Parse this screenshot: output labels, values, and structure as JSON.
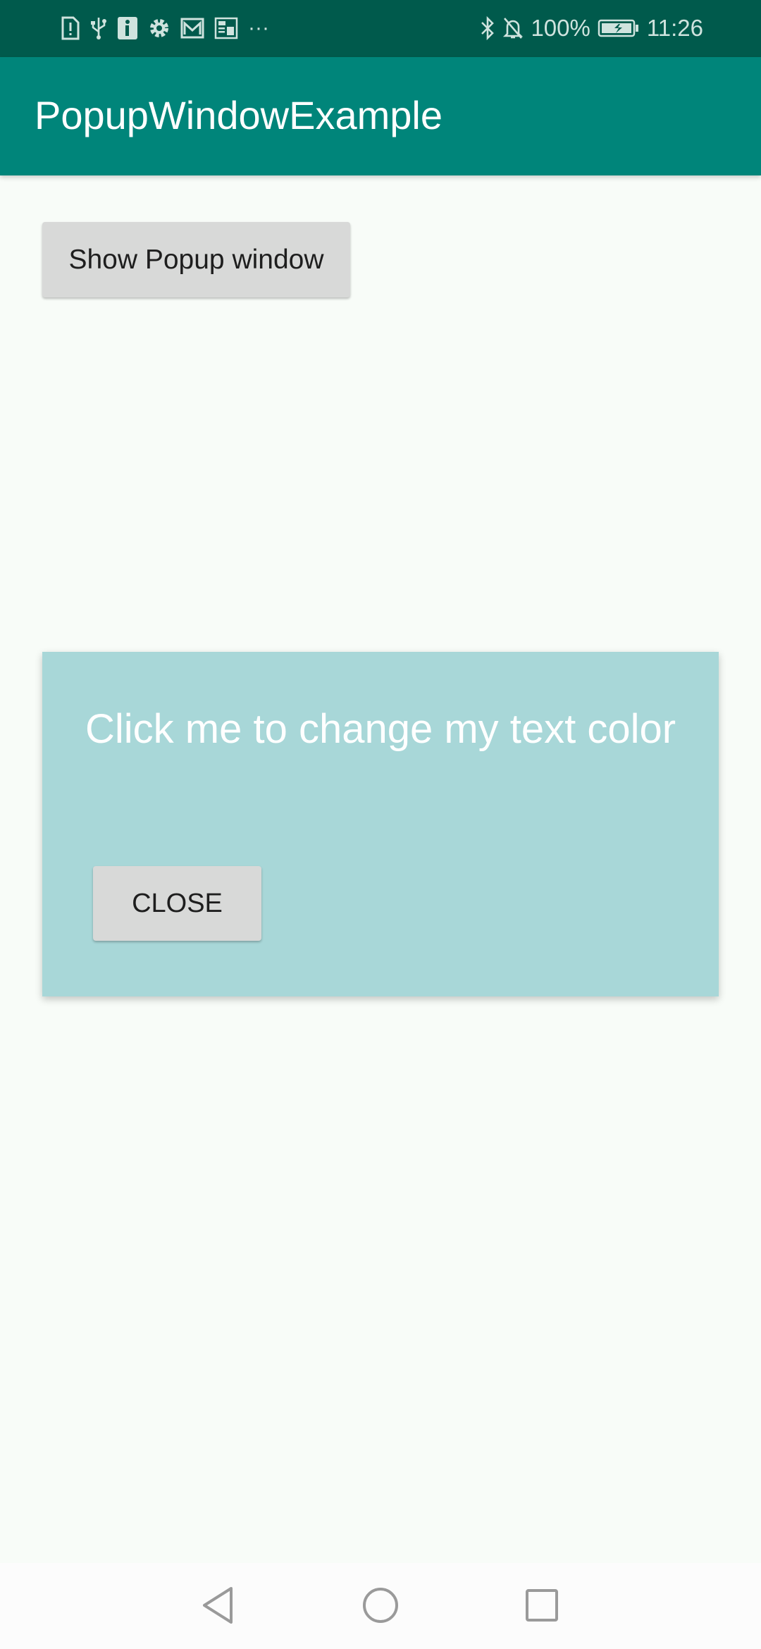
{
  "status_bar": {
    "icons_left": [
      "sim-alert-icon",
      "usb-icon",
      "info-icon",
      "settings-icon",
      "mail-icon",
      "news-icon",
      "more-dots-icon"
    ],
    "more_label": "···",
    "battery_percent": "100%",
    "time": "11:26",
    "icons_right": [
      "bluetooth-icon",
      "bell-off-icon",
      "battery-charging-icon"
    ]
  },
  "app_bar": {
    "title": "PopupWindowExample",
    "color": "#00857a"
  },
  "main": {
    "show_popup_label": "Show Popup window"
  },
  "popup": {
    "text": "Click me to change my text color",
    "close_label": "CLOSE",
    "background": "#a8d7d8"
  },
  "nav_bar": {
    "buttons": [
      "back-icon",
      "home-icon",
      "recents-icon"
    ]
  },
  "colors": {
    "status_bar": "#005a4c",
    "background": "#f8fcf8",
    "button": "#d8d9d8"
  }
}
